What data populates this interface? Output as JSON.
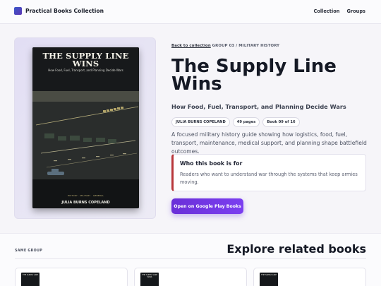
{
  "brand": {
    "name": "Practical Books Collection"
  },
  "nav": {
    "items": [
      "Collection",
      "Groups"
    ]
  },
  "breadcrumb": {
    "back": "Back to collection",
    "group": "GROUP 03 / MILITARY HISTORY"
  },
  "book": {
    "title": "The Supply Line Wins",
    "subtitle": "How Food, Fuel, Transport, and Planning Decide Wars",
    "cover_title_line1": "THE SUPPLY LINE",
    "cover_title_line2": "WINS",
    "cover_subtitle": "How Food, Fuel, Transport, and Planning Decide Wars",
    "cover_tags": "HISTORY · MILITARY · GENERAL",
    "cover_author": "JULIA BURNS COPELAND",
    "badges": [
      "JULIA BURNS COPELAND",
      "49 pages",
      "Book 09 of 16"
    ],
    "description": "A focused military history guide showing how logistics, food, fuel, transport, maintenance, medical support, and planning shape battlefield outcomes."
  },
  "audience": {
    "title": "Who this book is for",
    "text": "Readers who want to understand war through the systems that keep armies moving."
  },
  "cta": {
    "label": "Open on Google Play Books"
  },
  "related": {
    "label": "SAME GROUP",
    "heading": "Explore related books",
    "cards": [
      {
        "thumb_title": "THE SUPPLY LINE"
      },
      {
        "thumb_title": "THE SUPPLY LINE WINS"
      },
      {
        "thumb_title": "THE SUPPLY LINE"
      }
    ]
  },
  "colors": {
    "accent": "#7b3ef0",
    "audience_border": "#b8363a",
    "brand": "#3a56c9"
  }
}
